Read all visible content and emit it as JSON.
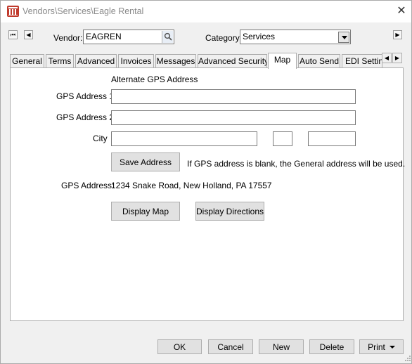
{
  "window": {
    "title": "Vendors\\Services\\Eagle Rental",
    "close_glyph": "✕"
  },
  "nav": {
    "first_glyph": "⏮",
    "prev_glyph": "◀",
    "next_glyph": "▶"
  },
  "header": {
    "vendor_label": "Vendor:",
    "vendor_value": "EAGREN",
    "category_label": "Category:",
    "category_value": "Services"
  },
  "tabs": [
    {
      "label": "General"
    },
    {
      "label": "Terms"
    },
    {
      "label": "Advanced"
    },
    {
      "label": "Invoices"
    },
    {
      "label": "Messages"
    },
    {
      "label": "Advanced Security"
    },
    {
      "label": "Map",
      "active": true
    },
    {
      "label": "Auto Send"
    },
    {
      "label": "EDI Settings"
    }
  ],
  "tab_scroll": {
    "left_glyph": "◀",
    "right_glyph": "▶"
  },
  "map": {
    "section_title": "Alternate GPS Address",
    "gps1_label": "GPS Address 1",
    "gps1_value": "",
    "gps2_label": "GPS Address 2",
    "gps2_value": "",
    "city_label": "City",
    "city_value": "",
    "state_value": "",
    "zip_value": "",
    "save_label": "Save Address",
    "save_note": "If GPS address is blank, the General address will be used.",
    "gps_address_label": "GPS Address:",
    "gps_address_value": "1234 Snake Road, New Holland, PA 17557",
    "display_map_label": "Display Map",
    "display_directions_label": "Display Directions"
  },
  "footer": {
    "ok": "OK",
    "cancel": "Cancel",
    "new": "New",
    "delete": "Delete",
    "print": "Print"
  },
  "colors": {
    "app_icon": "#c0392b",
    "panel_bg": "#ffffff",
    "window_bg": "#f0f0f0"
  }
}
